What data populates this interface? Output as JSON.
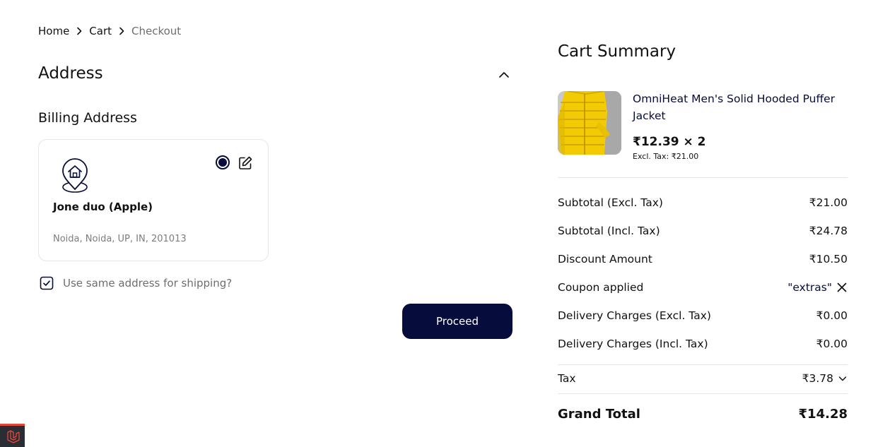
{
  "breadcrumb": {
    "home": "Home",
    "cart": "Cart",
    "checkout": "Checkout"
  },
  "address": {
    "title": "Address",
    "billing_title": "Billing Address",
    "card": {
      "name": "Jone duo (Apple)",
      "line": "Noida, Noida, UP, IN, 201013"
    },
    "same_address_label": "Use same address for shipping?",
    "proceed_label": "Proceed"
  },
  "summary": {
    "title": "Cart Summary",
    "item": {
      "name": "OmniHeat Men's Solid Hooded Puffer Jacket",
      "price_qty": "₹12.39 × 2",
      "excl_tax": "Excl. Tax: ₹21.00"
    },
    "rows": {
      "subtotal_excl_label": "Subtotal (Excl. Tax)",
      "subtotal_excl_value": "₹21.00",
      "subtotal_incl_label": "Subtotal (Incl. Tax)",
      "subtotal_incl_value": "₹24.78",
      "discount_label": "Discount Amount",
      "discount_value": "₹10.50",
      "coupon_label": "Coupon applied",
      "coupon_value": "\"extras\"",
      "delivery_excl_label": "Delivery Charges (Excl. Tax)",
      "delivery_excl_value": "₹0.00",
      "delivery_incl_label": "Delivery Charges (Incl. Tax)",
      "delivery_incl_value": "₹0.00",
      "tax_label": "Tax",
      "tax_value": "₹3.78",
      "grand_total_label": "Grand Total",
      "grand_total_value": "₹14.28"
    }
  },
  "icons": {
    "breadcrumb_separator": "chevron-right-icon",
    "collapse": "chevron-up-icon",
    "address": "home-location-pin-icon",
    "edit": "edit-icon",
    "checkbox": "checkbox-checked-icon",
    "remove_coupon": "close-icon",
    "tax_expand": "chevron-down-icon",
    "debug_badge": "laravel-logo-icon"
  },
  "colors": {
    "primary": "#060c3b",
    "product_yellow": "#f2cb05",
    "badge_bg": "#2a2d33",
    "badge_accent": "#e3493a"
  }
}
